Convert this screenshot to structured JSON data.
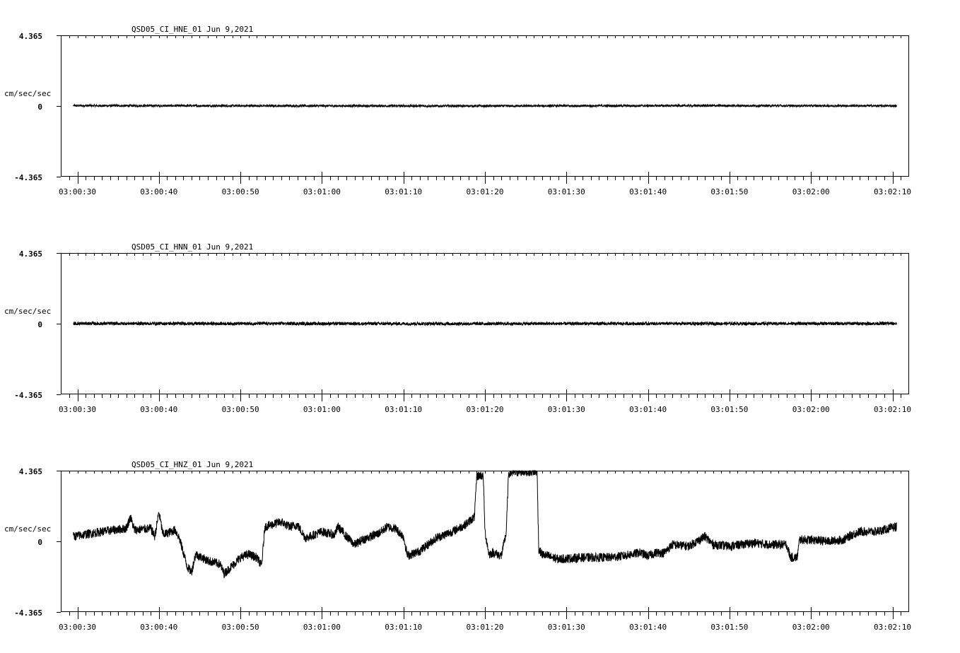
{
  "chart_data": [
    {
      "type": "line",
      "title": "QSD05_CI_HNE_01  Jun 9,2021",
      "ylabel": "cm/sec/sec",
      "ylim": [
        -4.365,
        4.365
      ],
      "yticks": [
        "4.365",
        "0",
        "-4.365"
      ],
      "x_major_ticks": [
        "03:00:30",
        "03:00:40",
        "03:00:50",
        "03:01:00",
        "03:01:10",
        "03:01:20",
        "03:01:30",
        "03:01:40",
        "03:01:50",
        "03:02:00",
        "03:02:10"
      ],
      "x_range_seconds_from_first_tick": [
        -2.0,
        102.0
      ],
      "trace": {
        "t_start": -0.5,
        "t_end": 100.5,
        "points": [
          [
            -0.5,
            0.02
          ],
          [
            25,
            0.01
          ],
          [
            50,
            0.0
          ],
          [
            75,
            0.02
          ],
          [
            100.5,
            0.01
          ]
        ],
        "noise_amplitude": 0.07
      },
      "grid": false,
      "legend": "none"
    },
    {
      "type": "line",
      "title": "QSD05_CI_HNN_01  Jun 9,2021",
      "ylabel": "cm/sec/sec",
      "ylim": [
        -4.365,
        4.365
      ],
      "yticks": [
        "4.365",
        "0",
        "-4.365"
      ],
      "x_major_ticks": [
        "03:00:30",
        "03:00:40",
        "03:00:50",
        "03:01:00",
        "03:01:10",
        "03:01:20",
        "03:01:30",
        "03:01:40",
        "03:01:50",
        "03:02:00",
        "03:02:10"
      ],
      "x_range_seconds_from_first_tick": [
        -2.0,
        102.0
      ],
      "trace": {
        "t_start": -0.5,
        "t_end": 100.5,
        "points": [
          [
            -0.5,
            0.01
          ],
          [
            50,
            0.0
          ],
          [
            100.5,
            0.01
          ]
        ],
        "noise_amplitude": 0.1
      },
      "grid": false,
      "legend": "none"
    },
    {
      "type": "line",
      "title": "QSD05_CI_HNZ_01  Jun 9,2021",
      "ylabel": "cm/sec/sec",
      "ylim": [
        -4.365,
        4.365
      ],
      "yticks": [
        "4.365",
        "0",
        "-4.365"
      ],
      "x_major_ticks": [
        "03:00:30",
        "03:00:40",
        "03:00:50",
        "03:01:00",
        "03:01:10",
        "03:01:20",
        "03:01:30",
        "03:01:40",
        "03:01:50",
        "03:02:00",
        "03:02:10"
      ],
      "x_range_seconds_from_first_tick": [
        -2.0,
        102.0
      ],
      "trace": {
        "t_start": -0.5,
        "t_end": 100.5,
        "points": [
          [
            -0.5,
            0.3
          ],
          [
            3,
            0.6
          ],
          [
            6,
            0.8
          ],
          [
            6.5,
            1.5
          ],
          [
            7,
            0.7
          ],
          [
            9,
            0.8
          ],
          [
            9.5,
            0.3
          ],
          [
            10,
            1.8
          ],
          [
            10.5,
            0.4
          ],
          [
            12,
            0.7
          ],
          [
            12.5,
            0.2
          ],
          [
            13.5,
            -1.6
          ],
          [
            14,
            -1.9
          ],
          [
            14.5,
            -0.8
          ],
          [
            16,
            -1.2
          ],
          [
            17.5,
            -1.4
          ],
          [
            18,
            -2.0
          ],
          [
            19,
            -1.5
          ],
          [
            20,
            -1.0
          ],
          [
            21,
            -0.8
          ],
          [
            22,
            -1.0
          ],
          [
            22.6,
            -1.5
          ],
          [
            23,
            0.9
          ],
          [
            25,
            1.2
          ],
          [
            26,
            0.9
          ],
          [
            27,
            1.0
          ],
          [
            28,
            0.2
          ],
          [
            30,
            0.6
          ],
          [
            31.5,
            0.4
          ],
          [
            32,
            0.9
          ],
          [
            33,
            0.3
          ],
          [
            34,
            -0.2
          ],
          [
            35,
            0.1
          ],
          [
            37,
            0.5
          ],
          [
            38,
            0.9
          ],
          [
            39,
            0.8
          ],
          [
            40,
            0.3
          ],
          [
            40.5,
            -0.9
          ],
          [
            42,
            -0.6
          ],
          [
            44,
            0.2
          ],
          [
            46,
            0.6
          ],
          [
            47.5,
            1.0
          ],
          [
            48.7,
            1.5
          ],
          [
            49.0,
            4.0
          ],
          [
            49.4,
            4.1
          ],
          [
            49.8,
            4.0
          ],
          [
            50.0,
            0.6
          ],
          [
            50.5,
            -0.8
          ],
          [
            51,
            -0.7
          ],
          [
            52,
            -0.9
          ],
          [
            52.6,
            0.5
          ],
          [
            52.9,
            4.2
          ],
          [
            54.5,
            4.3
          ],
          [
            56,
            4.3
          ],
          [
            56.4,
            4.3
          ],
          [
            56.6,
            -0.5
          ],
          [
            57,
            -0.8
          ],
          [
            59,
            -1.1
          ],
          [
            62,
            -1.0
          ],
          [
            65,
            -1.0
          ],
          [
            67,
            -0.9
          ],
          [
            69,
            -0.7
          ],
          [
            70,
            -0.9
          ],
          [
            71,
            -0.7
          ],
          [
            72,
            -0.7
          ],
          [
            73,
            -0.2
          ],
          [
            75,
            -0.3
          ],
          [
            77,
            0.3
          ],
          [
            78,
            -0.2
          ],
          [
            80,
            -0.3
          ],
          [
            83,
            -0.1
          ],
          [
            85,
            -0.2
          ],
          [
            87,
            -0.2
          ],
          [
            87.5,
            -1.0
          ],
          [
            88.3,
            -1.0
          ],
          [
            88.6,
            0.1
          ],
          [
            90,
            0.1
          ],
          [
            92,
            0.0
          ],
          [
            94,
            0.1
          ],
          [
            95,
            0.4
          ],
          [
            96,
            0.6
          ],
          [
            98,
            0.6
          ],
          [
            100.5,
            0.9
          ]
        ],
        "noise_amplitude": 0.28
      },
      "grid": false,
      "legend": "none"
    }
  ]
}
